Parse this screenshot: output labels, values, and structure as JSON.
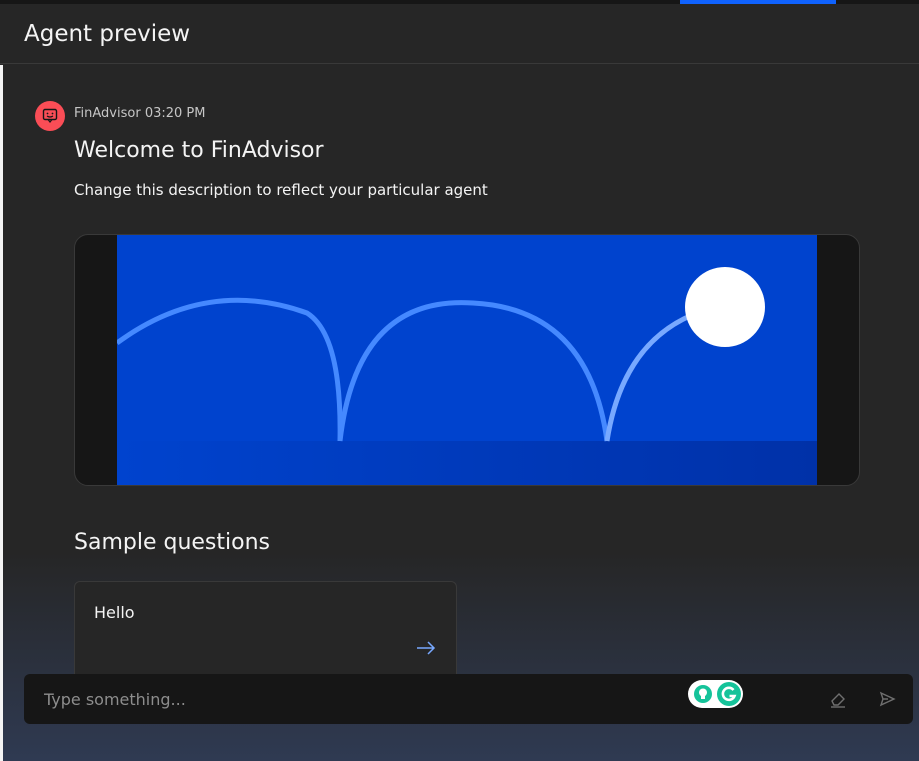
{
  "header": {
    "title": "Agent preview"
  },
  "message": {
    "sender": "FinAdvisor",
    "time": "03:20 PM",
    "title": "Welcome to FinAdvisor",
    "description": "Change this description to reflect your particular agent"
  },
  "samples": {
    "heading": "Sample questions",
    "items": [
      {
        "label": "Hello"
      }
    ]
  },
  "input": {
    "placeholder": "Type something..."
  },
  "colors": {
    "accent": "#0f62fe",
    "avatar": "#fa4d56",
    "banner_blue": "#0043ce",
    "grammarly": "#15c39a"
  },
  "icons": {
    "avatar": "chat-bot-icon",
    "card_arrow": "arrow-right-icon",
    "clear": "eraser-icon",
    "send": "send-icon",
    "grammarly_bulb": "grammarly-bulb-icon",
    "grammarly_logo": "grammarly-logo-icon"
  }
}
